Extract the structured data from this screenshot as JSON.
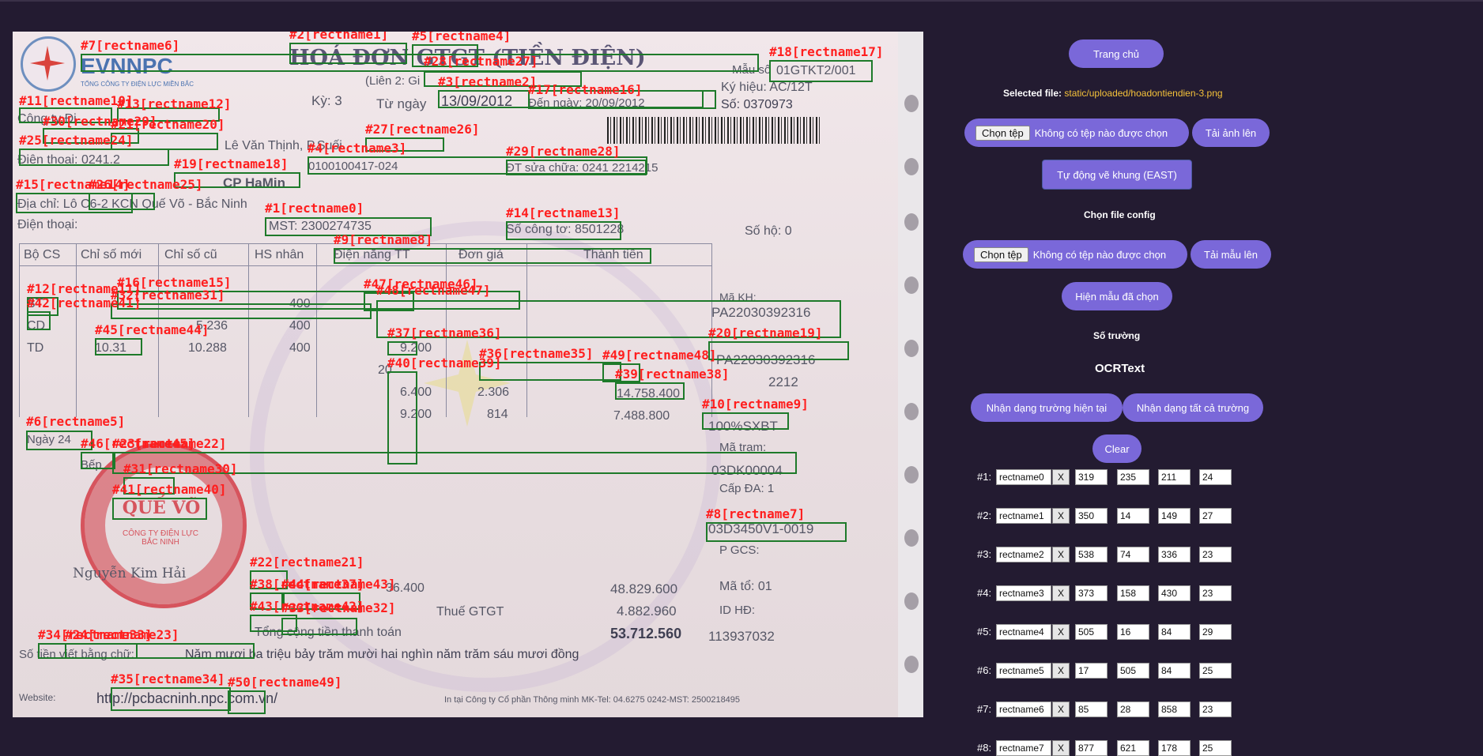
{
  "nav": {
    "home_label": "Trang chủ"
  },
  "selected_file": {
    "label": "Selected file:",
    "path": "static/uploaded/hoadontiendien-3.png"
  },
  "upload": {
    "file_button": "Chọn tệp",
    "file_status": "Không có tệp nào được chọn",
    "submit_label": "Tải ảnh lên"
  },
  "auto_draw_label": "Tự động vẽ khung (EAST)",
  "config": {
    "heading": "Chọn file config",
    "file_button": "Chọn tệp",
    "file_status": "Không có tệp nào được chọn",
    "submit_label": "Tải mẫu lên"
  },
  "show_template_label": "Hiện mẫu đã chọn",
  "field_count_label": "Số trường",
  "ocr_heading": "OCRText",
  "recognize_current_label": "Nhận dạng trường hiện tại",
  "recognize_all_label": "Nhận dạng tất cả trường",
  "clear_label": "Clear",
  "x_label": "X",
  "fields": [
    {
      "index": "#1:",
      "name": "rectname0",
      "v1": "319",
      "v2": "235",
      "v3": "211",
      "v4": "24"
    },
    {
      "index": "#2:",
      "name": "rectname1",
      "v1": "350",
      "v2": "14",
      "v3": "149",
      "v4": "27"
    },
    {
      "index": "#3:",
      "name": "rectname2",
      "v1": "538",
      "v2": "74",
      "v3": "336",
      "v4": "23"
    },
    {
      "index": "#4:",
      "name": "rectname3",
      "v1": "373",
      "v2": "158",
      "v3": "430",
      "v4": "23"
    },
    {
      "index": "#5:",
      "name": "rectname4",
      "v1": "505",
      "v2": "16",
      "v3": "84",
      "v4": "29"
    },
    {
      "index": "#6:",
      "name": "rectname5",
      "v1": "17",
      "v2": "505",
      "v3": "84",
      "v4": "25"
    },
    {
      "index": "#7:",
      "name": "rectname6",
      "v1": "85",
      "v2": "28",
      "v3": "858",
      "v4": "23"
    },
    {
      "index": "#8:",
      "name": "rectname7",
      "v1": "877",
      "v2": "621",
      "v3": "178",
      "v4": "25"
    }
  ],
  "invoice": {
    "brand": "EVNNPC",
    "company": "TỔNG CÔNG TY ĐIỆN LỰC MIỀN BẮC",
    "title": "HOÁ ĐƠN GTGT (TIỀN ĐIỆN)",
    "lien": "(Liên 2: Gi",
    "ky": "Kỳ: 3",
    "tu_ngay": "Từ ngày",
    "date_from": "13/09/2012",
    "den_ngay": "Đến ngày: 20/09/2012",
    "mau_so": "Mẫu số",
    "form_code": "01GTKT2/001",
    "ky_hieu": "Ký hiệu: AC/12T",
    "so": "Số: 0370973",
    "cong_ty": "Công ty Đi",
    "dia_chi_1": "Lê Văn Thịnh, P.Suối",
    "dien_thoai_1": "Điện thoại: 0241.2",
    "company_name": "CP HaMin",
    "dia_chi_2": "Địa chỉ: Lô C6-2 KCN Quế Võ - Bắc Ninh",
    "mst_1": "0100100417-024",
    "dt_sua_chua": "ĐT sửa chữa: 0241 2214215",
    "dien_thoai_2": "Điện thoại:",
    "mst_2": "MST: 2300274735",
    "so_cong_to": "Số công tơ: 8501228",
    "so_ho": "Số hộ: 0",
    "col_headers": [
      "Bộ CS",
      "Chỉ số mới",
      "Chỉ số cũ",
      "HS nhân",
      "Điện năng TT",
      "Đơn giá",
      "Thành tiền"
    ],
    "rows": [
      [
        "BT",
        "",
        "",
        "400",
        "",
        "",
        ""
      ],
      [
        "CD",
        "5.236",
        "",
        "400",
        "",
        "",
        ""
      ],
      [
        "TD",
        "10.31",
        "10.288",
        "400",
        "9.200",
        "",
        ""
      ]
    ],
    "more_values": [
      "20",
      "6.400",
      "2.306",
      "14.758.400",
      "9.200",
      "814",
      "7.488.800"
    ],
    "ma_kh_label": "Mã KH:",
    "ma_kh": "PA22030392316",
    "ma_kh_2": "PA22030392316",
    "ma_so": "2212",
    "ma_nn": "100%SXBT",
    "ngay": "Ngày 24",
    "ma_tram_label": "Mã trạm:",
    "ma_tram": "03DK00004",
    "bep_ngot": "Bếp",
    "cap_da": "Cấp ĐA: 1",
    "stamp": "QUẾ VÕ",
    "stamp_sub": "CÔNG TY ĐIỆN LỰC BẮC NINH",
    "signer": "Nguyễn Kim Hải",
    "gcs": "03D3450V1-0019",
    "p_gcs": "P GCS:",
    "ma_to": "Mã tổ: 01",
    "id_hd": "ID HĐ:",
    "id_value": "113937032",
    "amount_1": "36.400",
    "amount_2": "48.829.600",
    "vat_label": "Thuế GTGT",
    "vat": "4.882.960",
    "total_label": "Tổng cộng tiền thanh toán",
    "total": "53.712.560",
    "words_label": "Số tiền viết bằng chữ:",
    "words": "Năm mươi ba triệu bảy trăm mười hai nghìn năm trăm sáu mươi đồng",
    "website_label": "Website:",
    "website": "http://pcbacninh.npc.com.vn/",
    "footer": "In tại Công ty Cổ phần Thông minh MK-Tel: 04.6275 0242-MST: 2500218495"
  },
  "annotations": [
    "#7[rectname6]",
    "#2[rectname1]",
    "#5[rectname4]",
    "#18[rectname17]",
    "#28[rectname27]",
    "#3[rectname2]",
    "#17[rectname16]",
    "#11[rectname10]",
    "#13[rectname12]",
    "#30[rectname29]",
    "#21[rectname20]",
    "#27[rectname26]",
    "#25[rectname24]",
    "#4[rectname3]",
    "#29[rectname28]",
    "#19[rectname18]",
    "#15[rectname14]",
    "#26[rectname25]",
    "#1[rectname0]",
    "#14[rectname13]",
    "#9[rectname8]",
    "#16[rectname15]",
    "#47[rectname46]",
    "#12[rectname11]",
    "#48[rectname47]",
    "#32[rectname31]",
    "#42[rectname41]",
    "#45[rectname44]",
    "#37[rectname36]",
    "#20[rectname19]",
    "#36[rectname35]",
    "#49[rectname48]",
    "#40[rectname39]",
    "#39[rectname38]",
    "#10[rectname9]",
    "#6[rectname5]",
    "#46[rectname45]",
    "#23[rectname22]",
    "#31[rectname30]",
    "#41[rectname40]",
    "#8[rectname7]",
    "#22[rectname21]",
    "#38[rectname37]",
    "#44[rectname43]",
    "#43[rectname42]",
    "#33[rectname32]",
    "#34[rectname33]",
    "#24[rectname23]",
    "#35[rectname34]",
    "#50[rectname49]"
  ],
  "colors": {
    "background": "#231b31",
    "button": "#7a68d9",
    "file_path": "#f5c23a",
    "box": "#1e7a2a",
    "box_label": "#ff1e1e"
  }
}
